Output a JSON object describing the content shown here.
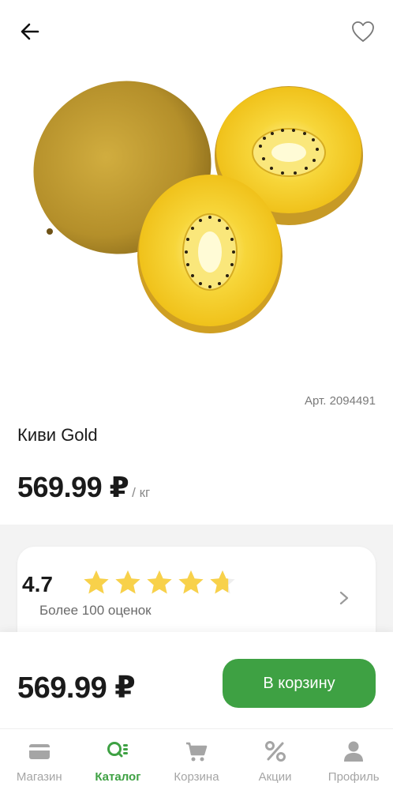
{
  "header": {
    "back_icon": "arrow-left-icon",
    "favorite_icon": "heart-outline-icon"
  },
  "product": {
    "article": "Арт. 2094491",
    "title": "Киви Gold",
    "price": "569.99 ₽",
    "unit": "/ кг",
    "image": "golden-kiwi-photo"
  },
  "rating": {
    "value": "4.7",
    "stars_fraction": 0.94,
    "subtitle": "Более 100 оценок",
    "star_color": "#f8d14a"
  },
  "buy_panel": {
    "price": "569.99 ₽",
    "button_label": "В корзину",
    "button_color": "#3ea143"
  },
  "tabbar": {
    "items": [
      {
        "label": "Магазин",
        "icon": "store-card-icon",
        "active": false
      },
      {
        "label": "Каталог",
        "icon": "catalog-search-icon",
        "active": true
      },
      {
        "label": "Корзина",
        "icon": "cart-icon",
        "active": false
      },
      {
        "label": "Акции",
        "icon": "percent-icon",
        "active": false
      },
      {
        "label": "Профиль",
        "icon": "profile-icon",
        "active": false
      }
    ],
    "active_color": "#3ea143",
    "inactive_color": "#a5a5a5"
  }
}
